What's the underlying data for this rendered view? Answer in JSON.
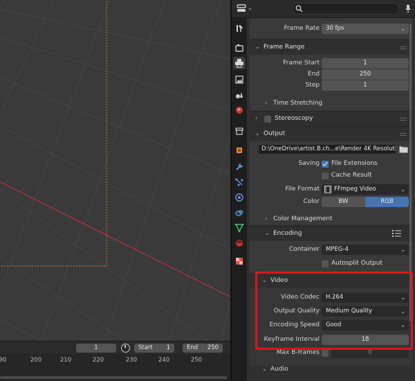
{
  "header": {
    "search": {
      "value": "",
      "placeholder": ""
    }
  },
  "properties": {
    "frame_rate": {
      "label": "Frame Rate",
      "value": "30 fps"
    },
    "frame_range": {
      "title": "Frame Range",
      "start": {
        "label": "Frame Start",
        "value": "1"
      },
      "end": {
        "label": "End",
        "value": "250"
      },
      "step": {
        "label": "Step",
        "value": "1"
      },
      "time_stretching": "Time Stretching"
    },
    "stereoscopy": {
      "title": "Stereoscopy"
    },
    "output": {
      "title": "Output",
      "path": "D:\\OneDrive\\artist.B.ch...e\\Render 4K Resolution\\",
      "saving_label": "Saving",
      "file_extensions": "File Extensions",
      "cache_result": "Cache Result",
      "file_format_label": "File Format",
      "file_format": "FFmpeg Video",
      "color_label": "Color",
      "color_bw": "BW",
      "color_rgb": "RGB",
      "color_management": "Color Management"
    },
    "encoding": {
      "title": "Encoding",
      "container_label": "Container",
      "container": "MPEG-4",
      "autosplit": "Autosplit Output"
    },
    "video": {
      "title": "Video",
      "codec_label": "Video Codec",
      "codec": "H.264",
      "quality_label": "Output Quality",
      "quality": "Medium Quality",
      "speed_label": "Encoding Speed",
      "speed": "Good",
      "keyframe_label": "Keyframe Interval",
      "keyframe": "18",
      "max_bframes_label": "Max B-frames",
      "max_bframes": "0"
    },
    "audio": {
      "title": "Audio"
    }
  },
  "timeline": {
    "current_frame": "1",
    "start_label": "Start",
    "start": "1",
    "end_label": "End",
    "end": "250",
    "ruler": [
      "90",
      "200",
      "210",
      "220",
      "230",
      "240",
      "250"
    ]
  },
  "colors": {
    "accent": "#4772b3",
    "highlight": "#e0141d",
    "camera_frame": "#e07a2c"
  }
}
